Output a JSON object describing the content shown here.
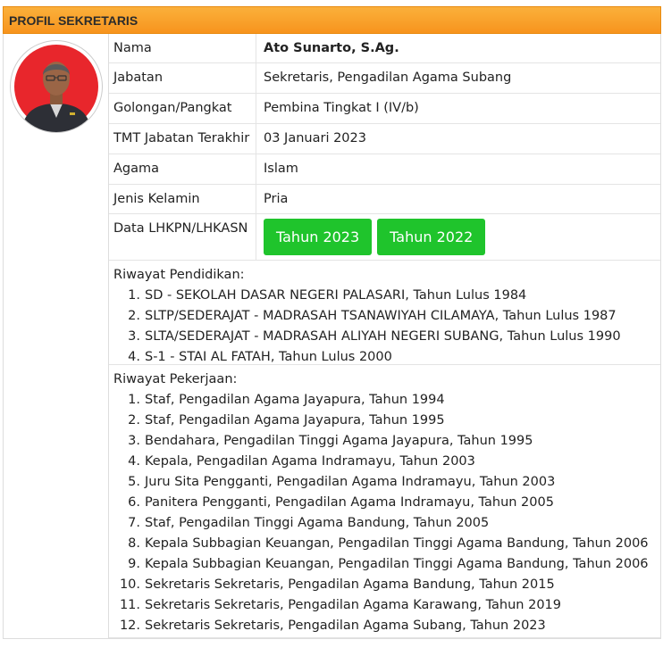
{
  "header": {
    "title": "PROFIL SEKRETARIS"
  },
  "profile": {
    "fields": [
      {
        "label": "Nama",
        "value": "Ato Sunarto, S.Ag."
      },
      {
        "label": "Jabatan",
        "value": "Sekretaris, Pengadilan Agama Subang"
      },
      {
        "label": "Golongan/Pangkat",
        "value": "Pembina Tingkat I (IV/b)"
      },
      {
        "label": "TMT Jabatan Terakhir",
        "value": "03 Januari 2023"
      },
      {
        "label": "Agama",
        "value": "Islam"
      },
      {
        "label": "Jenis Kelamin",
        "value": "Pria"
      }
    ],
    "lhkpn": {
      "label": "Data LHKPN/LHKASN",
      "buttons": [
        "Tahun 2023",
        "Tahun 2022"
      ]
    }
  },
  "education": {
    "title": "Riwayat Pendidikan:",
    "items": [
      "SD - SEKOLAH DASAR NEGERI PALASARI, Tahun Lulus 1984",
      "SLTP/SEDERAJAT - MADRASAH TSANAWIYAH CILAMAYA, Tahun Lulus 1987",
      "SLTA/SEDERAJAT - MADRASAH ALIYAH NEGERI SUBANG, Tahun Lulus 1990",
      "S-1 - STAI AL FATAH, Tahun Lulus 2000"
    ]
  },
  "work": {
    "title": "Riwayat Pekerjaan:",
    "items": [
      "Staf, Pengadilan Agama Jayapura, Tahun 1994",
      "Staf, Pengadilan Agama Jayapura, Tahun 1995",
      "Bendahara, Pengadilan Tinggi Agama Jayapura, Tahun 1995",
      "Kepala, Pengadilan Agama Indramayu, Tahun 2003",
      "Juru Sita Pengganti, Pengadilan Agama Indramayu, Tahun 2003",
      "Panitera Pengganti, Pengadilan Agama Indramayu, Tahun 2005",
      "Staf, Pengadilan Tinggi Agama Bandung, Tahun 2005",
      "Kepala Subbagian Keuangan, Pengadilan Tinggi Agama Bandung, Tahun 2006",
      "Kepala Subbagian Keuangan, Pengadilan Tinggi Agama Bandung, Tahun 2006",
      "Sekretaris Sekretaris, Pengadilan Agama Bandung, Tahun 2015",
      "Sekretaris Sekretaris, Pengadilan Agama Karawang, Tahun 2019",
      "Sekretaris Sekretaris, Pengadilan Agama Subang, Tahun 2023"
    ]
  },
  "colors": {
    "header": "#f7941d",
    "button": "#1fc42c",
    "photo_bg": "#e8262c"
  }
}
